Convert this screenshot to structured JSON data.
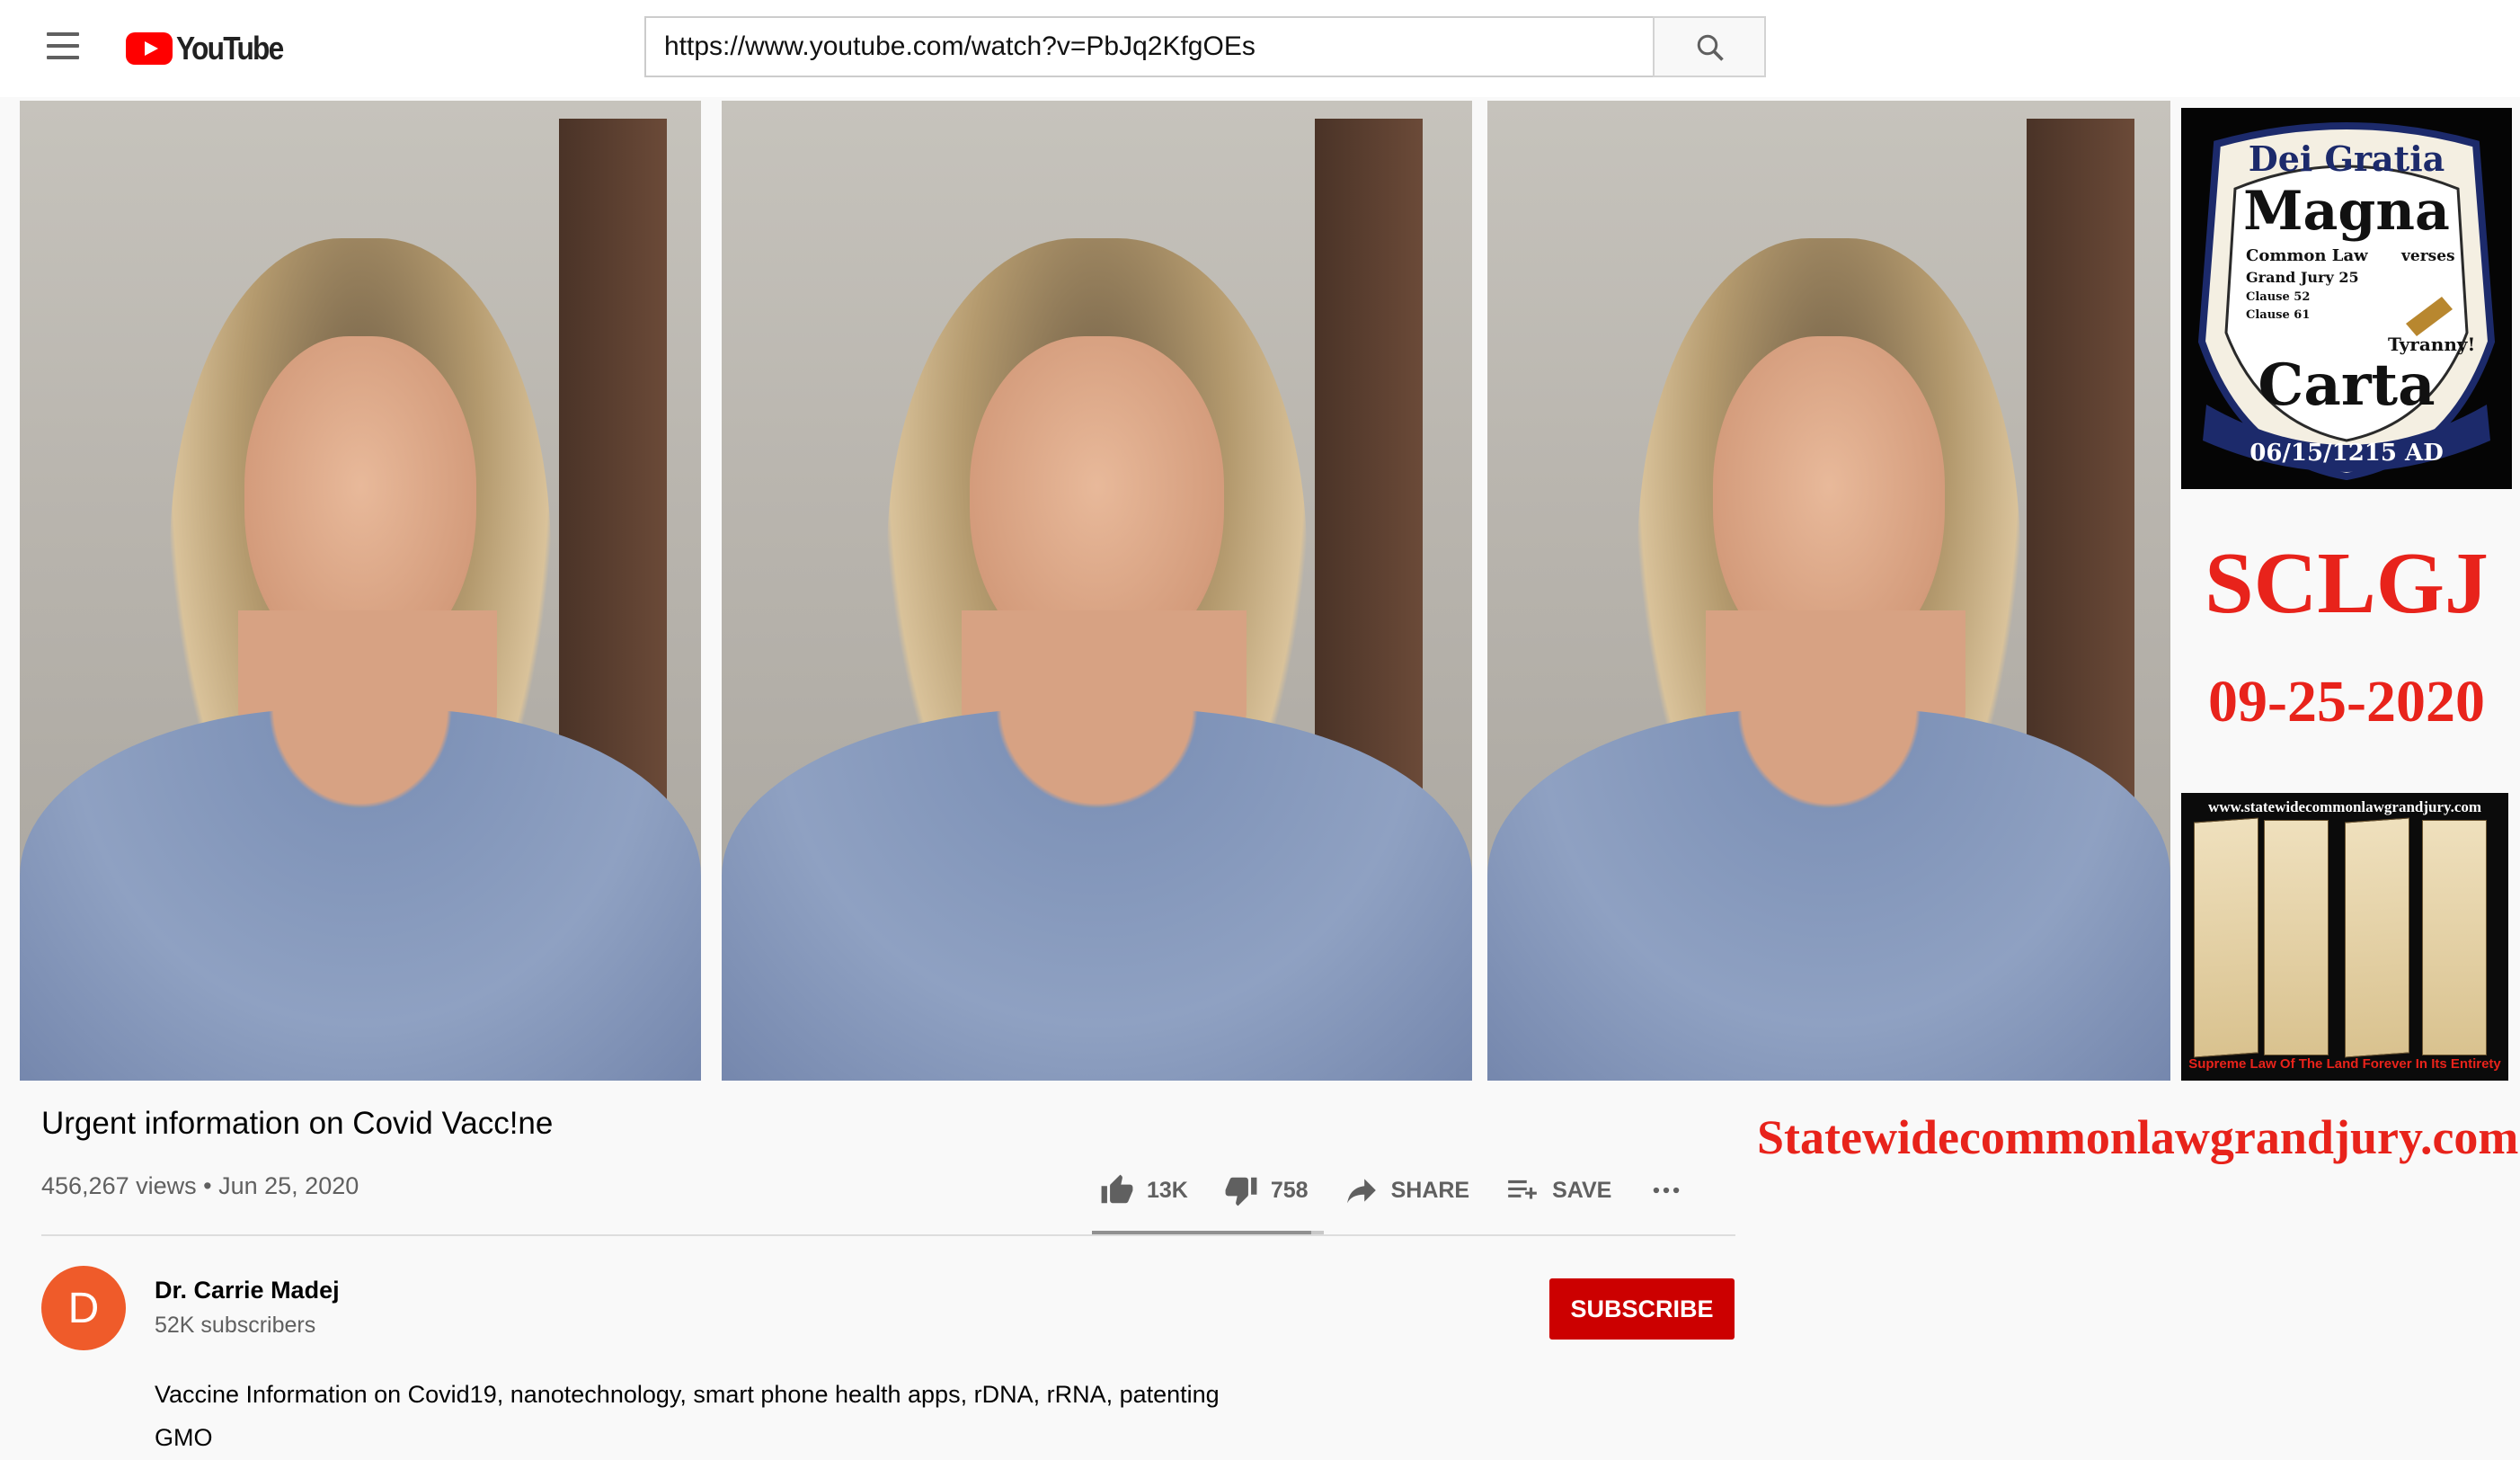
{
  "masthead": {
    "logo_text": "YouTube",
    "url": "https://www.youtube.com/watch?v=PbJq2KfgOEs"
  },
  "video": {
    "title": "Urgent information on Covid Vacc!ne",
    "views": "456,267 views",
    "separator": "•",
    "date": "Jun 25, 2020",
    "likes": "13K",
    "dislikes": "758",
    "like_ratio": 0.945,
    "share_label": "SHARE",
    "save_label": "SAVE"
  },
  "channel": {
    "avatar_letter": "D",
    "name": "Dr. Carrie Madej",
    "subscribers": "52K subscribers",
    "subscribe_label": "SUBSCRIBE"
  },
  "description": {
    "line1": "Vaccine Information on Covid19, nanotechnology, smart phone health apps, rDNA, rRNA, patenting",
    "line2": "GMO"
  },
  "ad": {
    "seal": {
      "top": "Dei Gratia",
      "word1": "Magna",
      "left_lines": [
        "Common Law",
        "Grand Jury 25",
        "Clause 52",
        "Clause 61"
      ],
      "right_top": "verses",
      "right_bottom": "Tyranny!",
      "word2": "Carta",
      "date": "06/15/1215 AD"
    },
    "headline": "SCLGJ",
    "date": "09-25-2020",
    "brochure_url": "www.statewidecommonlawgrandjury.com",
    "brochure_footer": "Supreme Law Of The Land Forever In Its Entirety",
    "site": "Statewidecommonlawgrandjury.com"
  },
  "colors": {
    "brand_red": "#ff0000",
    "subscribe_red": "#cc0000",
    "ad_red": "#e8231b",
    "avatar": "#ef5b2a"
  }
}
